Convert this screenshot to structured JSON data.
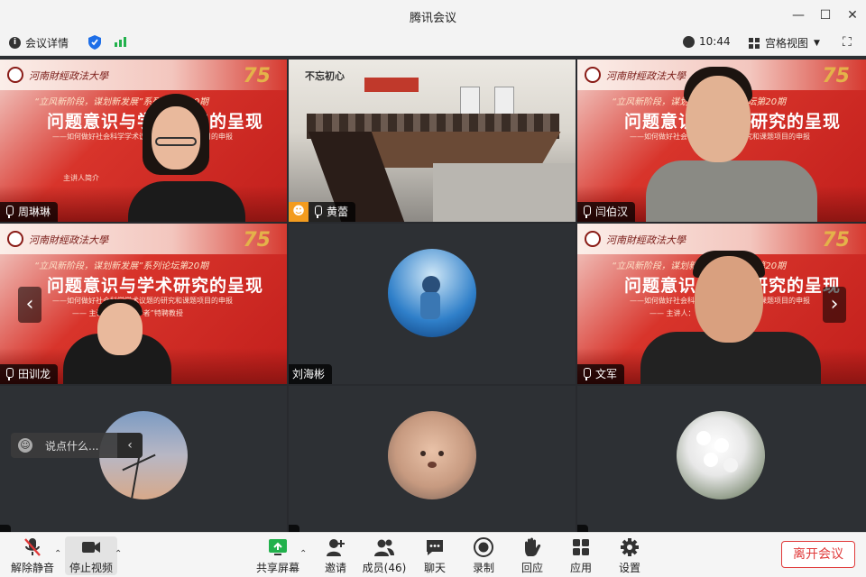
{
  "window": {
    "title": "腾讯会议"
  },
  "infobar": {
    "meeting_details": "会议详情",
    "time": "10:44",
    "view_mode": "宫格视图"
  },
  "slide": {
    "school": "河南財經政法大學",
    "anniversary": "75",
    "subtitle_top": "“立风新阶段，谋划新发展”系列论坛第20期",
    "title": "问题意识与学术研究的呈现",
    "subtitle_1": "——如何做好社会科学学术议题的研究和课题项目的申报",
    "subtitle_2": "—— 主讲人：“长江学者”特聘教授",
    "host_intro": "主讲人简介"
  },
  "room_sign": "不忘初心",
  "participants": [
    {
      "name": "周琳琳"
    },
    {
      "name": "黄蕾"
    },
    {
      "name": "闫伯汉"
    },
    {
      "name": "田训龙"
    },
    {
      "name": "刘海彬"
    },
    {
      "name": "文军"
    },
    {
      "name": ""
    },
    {
      "name": ""
    },
    {
      "name": ""
    }
  ],
  "chat": {
    "placeholder": "说点什么..."
  },
  "toolbar": {
    "unmute": "解除静音",
    "stop_video": "停止视频",
    "share_screen": "共享屏幕",
    "invite": "邀请",
    "members": "成员(46)",
    "chat": "聊天",
    "record": "录制",
    "reactions": "回应",
    "apps": "应用",
    "settings": "设置",
    "leave": "离开会议"
  },
  "colors": {
    "accent_green": "#22b14c",
    "leave_red": "#e03a3a",
    "slide_red": "#c21f1c"
  }
}
